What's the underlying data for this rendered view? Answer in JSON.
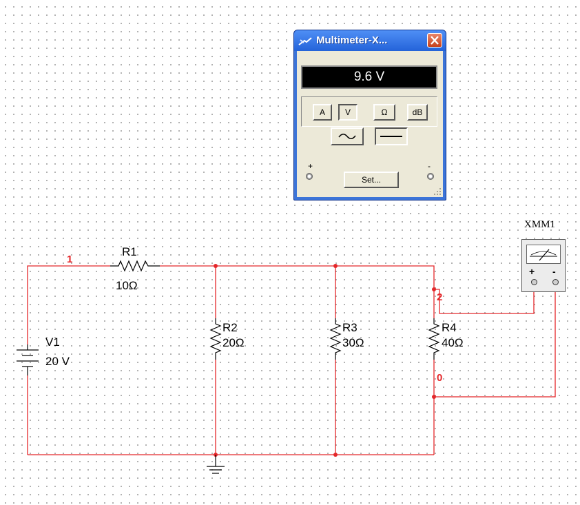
{
  "multimeter": {
    "title": "Multimeter-X...",
    "display": "9.6 V",
    "buttons": {
      "amps": "A",
      "volts": "V",
      "ohms": "Ω",
      "db": "dB"
    },
    "selected_mode": "volts",
    "signal_selected": "dc",
    "plus_label": "+",
    "minus_label": "-",
    "set_label": "Set..."
  },
  "instrument": {
    "name": "XMM1",
    "plus_label": "+",
    "minus_label": "-"
  },
  "components": {
    "v1": {
      "name": "V1",
      "value": "20 V"
    },
    "r1": {
      "name": "R1",
      "value": "10Ω"
    },
    "r2": {
      "name": "R2",
      "value": "20Ω"
    },
    "r3": {
      "name": "R3",
      "value": "30Ω"
    },
    "r4": {
      "name": "R4",
      "value": "40Ω"
    }
  },
  "nodes": {
    "n1": "1",
    "n2": "2",
    "n0": "0"
  },
  "colors": {
    "wire": "#e4272a",
    "titlebar": "#2463d9",
    "panel": "#ece9d8"
  }
}
